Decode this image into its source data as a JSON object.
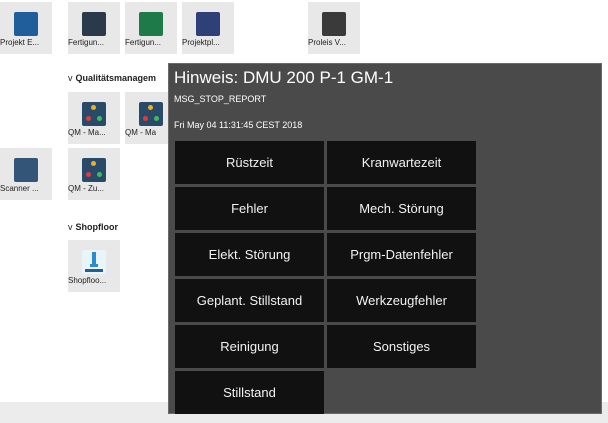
{
  "launcher": {
    "tiles": [
      {
        "label": "Projekt E...",
        "icon": "search-document-icon"
      },
      {
        "label": "Fertigun...",
        "icon": "monitor-icon"
      },
      {
        "label": "Fertigun...",
        "icon": "network-icon"
      },
      {
        "label": "Projektpl...",
        "icon": "grid-plan-icon"
      },
      {
        "label": "Proleis V...",
        "icon": "document-icon"
      }
    ],
    "section_quality": {
      "chevron": "v",
      "label": "Qualitätsmanagem"
    },
    "qm_tiles": [
      {
        "label": "QM - Ma...",
        "icon": "qm-icon"
      },
      {
        "label": "QM - Ma",
        "icon": "qm-icon"
      },
      {
        "label": "QM - Zu...",
        "icon": "qm-icon"
      }
    ],
    "scanner_tile": {
      "label": "Scanner ...",
      "icon": "scanner-icon"
    },
    "section_shopfloor": {
      "chevron": "v",
      "label": "Shopfloor"
    },
    "shopfloor_tile": {
      "label": "Shopfloo...",
      "icon": "shopfloor-icon"
    }
  },
  "dialog": {
    "title": "Hinweis: DMU 200 P-1 GM-1",
    "code": "MSG_STOP_REPORT",
    "date": "Fri May 04 11:31:45 CEST 2018",
    "buttons": [
      "Rüstzeit",
      "Kranwartezeit",
      "Fehler",
      "Mech. Störung",
      "Elekt. Störung",
      "Prgm-Datenfehler",
      "Geplant. Stillstand",
      "Werkzeugfehler",
      "Reinigung",
      "Sonstiges",
      "Stillstand"
    ]
  }
}
